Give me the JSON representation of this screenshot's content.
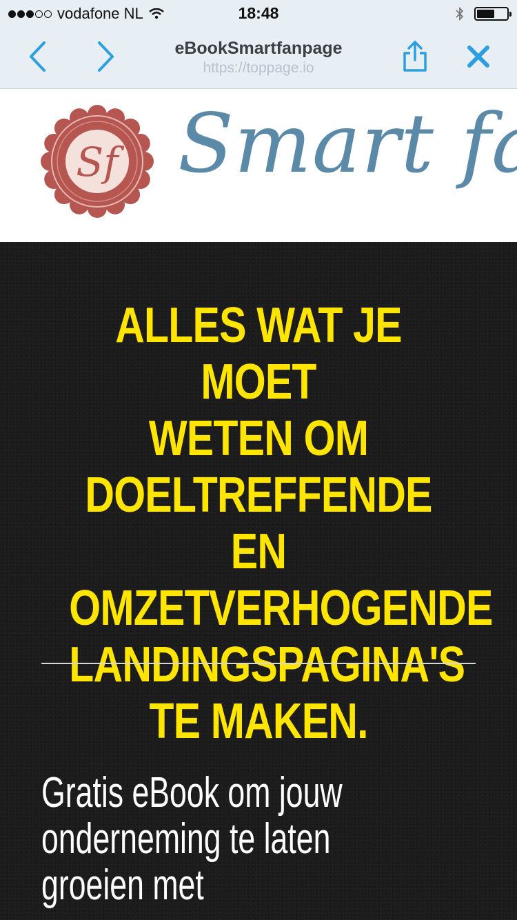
{
  "status_bar": {
    "carrier": "vodafone NL",
    "time": "18:48",
    "signal": {
      "filled": 3,
      "empty": 2
    },
    "battery_level": 0.6,
    "icons": [
      "wifi-icon",
      "bluetooth-icon",
      "battery-icon"
    ]
  },
  "browser": {
    "title": "eBookSmartfanpage",
    "url": "https://toppage.io",
    "icons": [
      "back-arrow-icon",
      "forward-arrow-icon",
      "share-icon",
      "close-icon"
    ],
    "accent": "#2d9fe0"
  },
  "logo": {
    "seal_text": "Sf",
    "brand_text": "Smart fanp",
    "brand_color": "#5a8aa8",
    "seal_color": "#b65651"
  },
  "hero": {
    "headline_lines": [
      "ALLES WAT JE MOET",
      "WETEN OM",
      "DOELTREFFENDE EN",
      "OMZETVERHOGENDE",
      "LANDINGSPAGINA'S",
      "TE MAKEN."
    ],
    "headline_color": "#ffe500",
    "subtext_lines": [
      "Gratis eBook om jouw",
      "onderneming te laten",
      "groeien met"
    ]
  }
}
